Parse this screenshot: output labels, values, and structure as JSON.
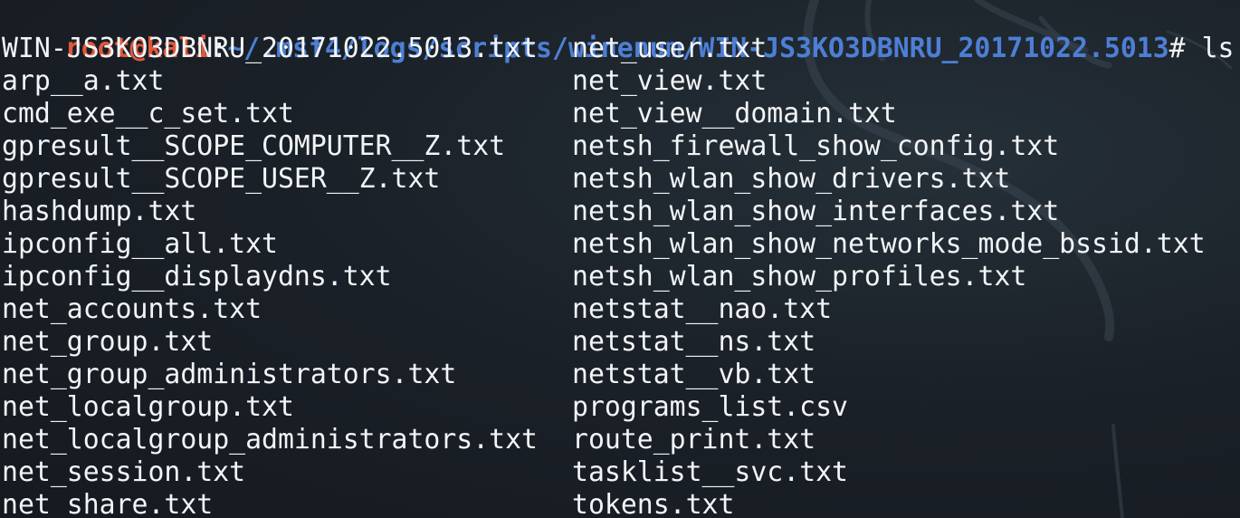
{
  "prompt": {
    "user_host": "root@kali",
    "separator": ":",
    "path": "~/.msf4/logs/scripts/winenum/WIN-JS3KO3DBNRU_20171022.5013",
    "symbol": "# ",
    "command": "ls"
  },
  "listing": {
    "column1": [
      "WIN-JS3KO3DBNRU_20171022.5013.txt",
      "arp__a.txt",
      "cmd_exe__c_set.txt",
      "gpresult__SCOPE_COMPUTER__Z.txt",
      "gpresult__SCOPE_USER__Z.txt",
      "hashdump.txt",
      "ipconfig__all.txt",
      "ipconfig__displaydns.txt",
      "net_accounts.txt",
      "net_group.txt",
      "net_group_administrators.txt",
      "net_localgroup.txt",
      "net_localgroup_administrators.txt",
      "net_session.txt",
      "net_share.txt"
    ],
    "column2": [
      "net_user.txt",
      "net_view.txt",
      "net_view__domain.txt",
      "netsh_firewall_show_config.txt",
      "netsh_wlan_show_drivers.txt",
      "netsh_wlan_show_interfaces.txt",
      "netsh_wlan_show_networks_mode_bssid.txt",
      "netsh_wlan_show_profiles.txt",
      "netstat__nao.txt",
      "netstat__ns.txt",
      "netstat__vb.txt",
      "programs_list.csv",
      "route_print.txt",
      "tasklist__svc.txt",
      "tokens.txt"
    ]
  },
  "colors": {
    "background": "#1a1f26",
    "text": "#f2f4f6",
    "prompt_user": "#e0573d",
    "prompt_path": "#4d7fd6"
  }
}
